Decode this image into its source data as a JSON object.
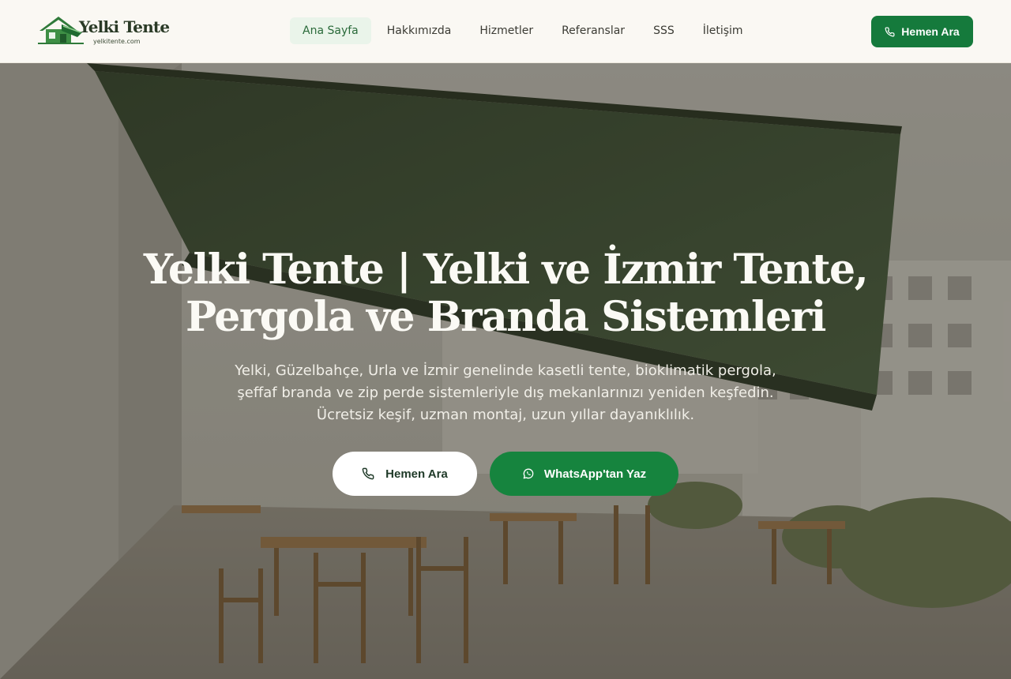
{
  "logo": {
    "title": "Yelki Tente",
    "domain": "yelkitente.com"
  },
  "nav": {
    "items": [
      {
        "label": "Ana Sayfa",
        "active": true
      },
      {
        "label": "Hakkımızda"
      },
      {
        "label": "Hizmetler"
      },
      {
        "label": "Referanslar"
      },
      {
        "label": "SSS"
      },
      {
        "label": "İletişim"
      }
    ]
  },
  "header": {
    "call_label": "Hemen Ara"
  },
  "hero": {
    "title_lines": [
      "Yelki Tente | Yelki ve İzmir Tente,",
      "Pergola ve Branda Sistemleri"
    ],
    "subtitle_lines": [
      "Yelki, Güzelbahçe, Urla ve İzmir genelinde kasetli tente, bioklimatik pergola,",
      "şeffaf branda ve zip perde sistemleriyle dış mekanlarınızı yeniden keşfedin.",
      "Ücretsiz keşif, uzman montaj, uzun yıllar dayanıklılık."
    ],
    "call_label": "Hemen Ara",
    "whatsapp_label": "WhatsApp'tan Yaz"
  },
  "colors": {
    "brand_green": "#157a3c",
    "active_nav_bg": "#eaf4ea",
    "awning": "#3f5233"
  },
  "icons": {
    "call": "phone-icon",
    "whatsapp": "whatsapp-icon",
    "logo": "house-icon"
  }
}
